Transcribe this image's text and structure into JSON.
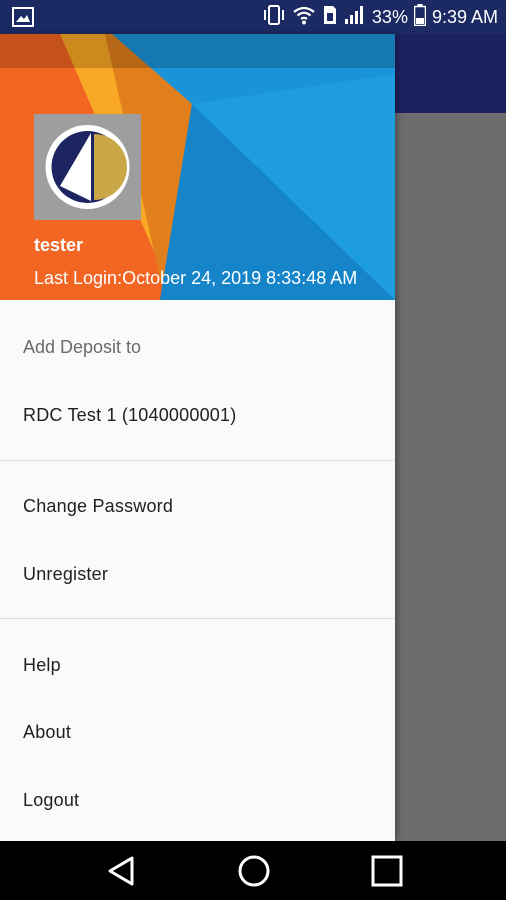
{
  "status_bar": {
    "battery": "33%",
    "time": "9:39 AM",
    "icons": [
      "image-icon",
      "vibrate-icon",
      "wifi-icon",
      "data-saver-icon",
      "signal-icon",
      "battery-icon"
    ]
  },
  "drawer": {
    "header": {
      "username": "tester",
      "last_login": "Last Login:October 24, 2019 8:33:48 AM"
    },
    "section_add_deposit": "Add Deposit to",
    "account": "RDC Test 1 (1040000001)",
    "items": {
      "change_password": "Change Password",
      "unregister": "Unregister",
      "help": "Help",
      "about": "About",
      "logout": "Logout"
    }
  },
  "nav_bar": {
    "icons": [
      "back-icon",
      "home-icon",
      "recents-icon"
    ]
  },
  "colors": {
    "status_bar": "#1b2a63",
    "app_bar": "#1c2260",
    "header_orange": "#f26522",
    "header_yellow": "#f9a825",
    "header_blue": "#1a93d8"
  }
}
